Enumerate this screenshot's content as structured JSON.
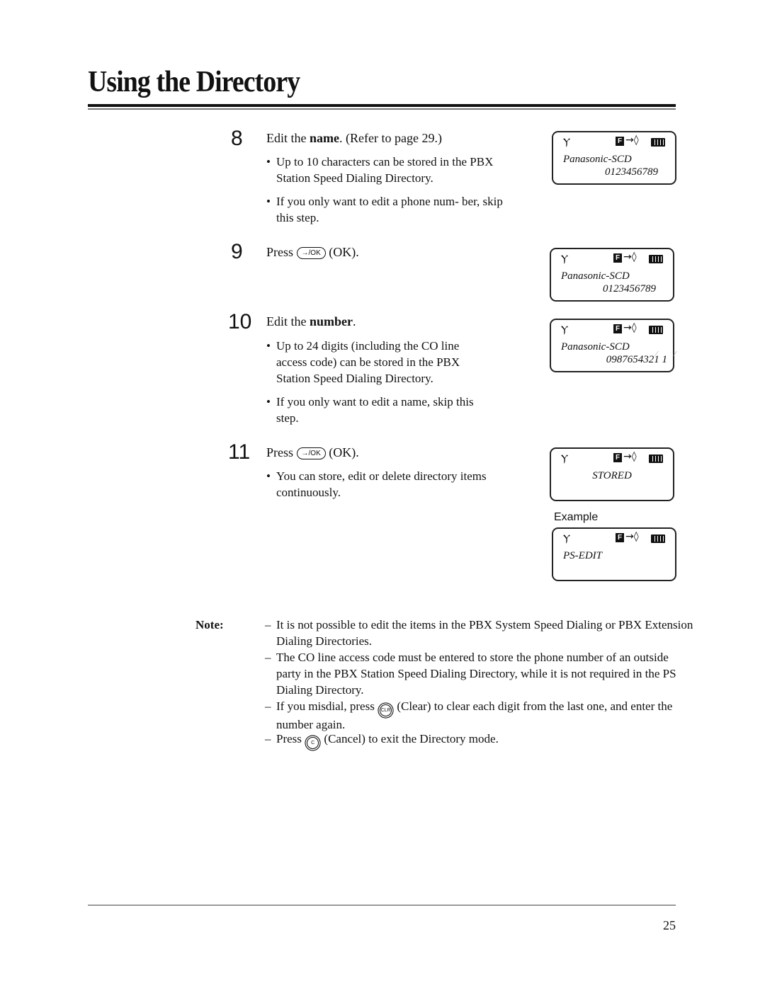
{
  "header": {
    "title": "Using the Directory"
  },
  "steps": [
    {
      "number": "8",
      "heading_pre": "Edit the ",
      "heading_bold": "name",
      "heading_post": ".  (Refer to page 29.)",
      "bullets": [
        "Up to 10 characters can be stored in the PBX Station Speed Dialing Directory.",
        "If you only want to edit a phone num- ber, skip this step."
      ]
    },
    {
      "number": "9",
      "heading_pre": "Press ",
      "key": "→/OK",
      "heading_post": " (OK)."
    },
    {
      "number": "10",
      "heading_pre": "Edit the ",
      "heading_bold": "number",
      "heading_post": ".",
      "bullets": [
        "Up to 24 digits (including the CO line access code) can be stored in the PBX Station Speed Dialing Directory.",
        "If you only want to edit a name, skip this step."
      ]
    },
    {
      "number": "11",
      "heading_pre": "Press ",
      "key": "→/OK",
      "heading_post": " (OK).",
      "bullets": [
        "You can store, edit or delete directory items continuously."
      ]
    }
  ],
  "displays": [
    {
      "line1": "Panasonic-SCD",
      "line2": "0123456789"
    },
    {
      "line1": "Panasonic-SCD",
      "line2": "0123456789"
    },
    {
      "line1": "Panasonic-SCD",
      "line2": "0987654321  1"
    },
    {
      "center": "STORED"
    },
    {
      "line1": "PS-EDIT"
    }
  ],
  "icons": {
    "antenna": "Ⲩ",
    "f_label": "F",
    "arrow": "→◊"
  },
  "example_label": "Example",
  "note": {
    "label": "Note:",
    "items": [
      "It is not possible to edit the items in the PBX System Speed Dialing or PBX Extension Dialing Directories.",
      "The CO line access code must be entered to store the phone number of an outside party in the PBX Station Speed Dialing Directory, while it is not required in the PS Dialing Directory.",
      {
        "pre": "If you misdial, press ",
        "key": "CLR",
        "post": " (Clear) to clear each digit from the last one, and enter the number again."
      },
      {
        "pre": "Press ",
        "key": "C",
        "post": " (Cancel) to exit the Directory mode."
      }
    ]
  },
  "page_number": "25"
}
